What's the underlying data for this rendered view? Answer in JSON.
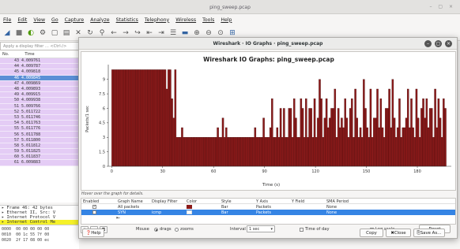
{
  "window": {
    "title": "ping_sweep.pcap",
    "controls": "– ▢ ×"
  },
  "menubar": [
    "File",
    "Edit",
    "View",
    "Go",
    "Capture",
    "Analyze",
    "Statistics",
    "Telephony",
    "Wireless",
    "Tools",
    "Help"
  ],
  "filter": {
    "placeholder": "Apply a display filter … <Ctrl-/>"
  },
  "packet_list": {
    "columns": [
      "No.",
      "Time"
    ],
    "rows": [
      {
        "no": "43",
        "time": "4.009761"
      },
      {
        "no": "44",
        "time": "4.009787"
      },
      {
        "no": "45",
        "time": "4.009818"
      },
      {
        "no": "46",
        "time": "4.009845"
      },
      {
        "no": "47",
        "time": "4.009869"
      },
      {
        "no": "48",
        "time": "4.009893"
      },
      {
        "no": "49",
        "time": "4.009915"
      },
      {
        "no": "50",
        "time": "4.009938"
      },
      {
        "no": "51",
        "time": "5.009766"
      },
      {
        "no": "52",
        "time": "5.011722"
      },
      {
        "no": "53",
        "time": "5.011746"
      },
      {
        "no": "54",
        "time": "5.011763"
      },
      {
        "no": "55",
        "time": "5.011776"
      },
      {
        "no": "56",
        "time": "5.011788"
      },
      {
        "no": "57",
        "time": "5.011800"
      },
      {
        "no": "58",
        "time": "5.011812"
      },
      {
        "no": "59",
        "time": "5.011825"
      },
      {
        "no": "60",
        "time": "5.011837"
      },
      {
        "no": "61",
        "time": "6.009883"
      }
    ],
    "selected_index": 3
  },
  "details": [
    "▸ Frame 46: 42 bytes",
    "▸ Ethernet II, Src: V",
    "▸ Internet Protocol V",
    "▸ Internet Control Me"
  ],
  "hex": [
    {
      "offset": "0000",
      "bytes": "00 00 00 00 00"
    },
    {
      "offset": "0010",
      "bytes": "00 1c 55 7f 00"
    },
    {
      "offset": "0020",
      "bytes": "2f 17 08 00 ec"
    }
  ],
  "io_dialog": {
    "window_title": "Wireshark · IO Graphs · ping_sweep.pcap",
    "hover_hint": "Hover over the graph for details.",
    "columns": [
      "Enabled",
      "Graph Name",
      "Display Filter",
      "Color",
      "Style",
      "Y Axis",
      "Y Field",
      "SMA Period"
    ],
    "graphs": [
      {
        "enabled": true,
        "name": "All packets",
        "filter": "",
        "color": "#8b1a1a",
        "style": "Bar",
        "y_axis": "Packets",
        "y_field": "",
        "sma": "None",
        "selected": false
      },
      {
        "enabled": false,
        "name": "SYN",
        "filter": "icmp",
        "color": "#ffffff",
        "style": "Bar",
        "y_axis": "Packets",
        "y_field": "",
        "sma": "None",
        "selected": true
      }
    ],
    "add_btn": "+",
    "remove_btn": "−",
    "copy_btn": "⧉",
    "mouse_label": "Mouse",
    "drags_label": "drags",
    "zooms_label": "zooms",
    "interval_label": "Interval",
    "interval_value": "1 sec",
    "time_of_day_label": "Time of day",
    "log_scale_label": "Log scale",
    "reset_btn": "Reset",
    "help_btn": "Help",
    "copy_text_btn": "Copy",
    "close_btn": "Close",
    "save_btn": "Save As…"
  },
  "chart_data": {
    "type": "bar",
    "title": "Wireshark IO Graphs: ping_sweep.pcap",
    "xlabel": "Time (s)",
    "ylabel": "Packets/1 sec",
    "xlim": [
      -2,
      200
    ],
    "ylim": [
      0,
      10.2
    ],
    "xticks": [
      0,
      30,
      60,
      90,
      120,
      150,
      180
    ],
    "yticks": [
      0,
      1.5,
      3,
      4.5,
      6,
      7.5,
      9
    ],
    "grid": false,
    "color": "#8b1a1a",
    "x": [
      0,
      1,
      2,
      3,
      4,
      5,
      6,
      7,
      8,
      9,
      10,
      11,
      12,
      13,
      14,
      15,
      16,
      17,
      18,
      19,
      20,
      21,
      22,
      23,
      24,
      25,
      26,
      27,
      28,
      29,
      30,
      31,
      32,
      33,
      34,
      35,
      36,
      37,
      38,
      39,
      40,
      41,
      42,
      43,
      44,
      45,
      46,
      47,
      48,
      49,
      50,
      51,
      52,
      53,
      54,
      55,
      56,
      57,
      58,
      59,
      60,
      61,
      62,
      63,
      64,
      65,
      66,
      67,
      68,
      69,
      70,
      71,
      72,
      73,
      74,
      75,
      76,
      77,
      78,
      79,
      80,
      81,
      82,
      83,
      84,
      85,
      86,
      87,
      88,
      89,
      90,
      91,
      92,
      93,
      94,
      95,
      96,
      97,
      98,
      99,
      100,
      101,
      102,
      103,
      104,
      105,
      106,
      107,
      108,
      109,
      110,
      111,
      112,
      113,
      114,
      115,
      116,
      117,
      118,
      119,
      120,
      121,
      122,
      123,
      124,
      125,
      126,
      127,
      128,
      129,
      130,
      131,
      132,
      133,
      134,
      135,
      136,
      137,
      138,
      139,
      140,
      141,
      142,
      143,
      144,
      145,
      146,
      147,
      148,
      149,
      150,
      151,
      152,
      153,
      154,
      155,
      156,
      157,
      158,
      159,
      160,
      161,
      162,
      163,
      164,
      165,
      166,
      167,
      168,
      169,
      170,
      171,
      172,
      173,
      174,
      175,
      176,
      177,
      178,
      179,
      180,
      181,
      182,
      183,
      184,
      185,
      186,
      187,
      188,
      189,
      190,
      191,
      192,
      193,
      194,
      195,
      196
    ],
    "values": [
      10,
      10,
      10,
      10,
      10,
      10,
      10,
      10,
      10,
      10,
      10,
      10,
      10,
      10,
      10,
      10,
      10,
      10,
      10,
      10,
      10,
      10,
      10,
      10,
      10,
      10,
      10,
      10,
      10,
      10,
      10,
      10,
      8,
      10,
      10,
      7,
      5,
      10,
      3,
      3,
      3,
      4,
      3,
      3,
      3,
      3,
      3,
      3,
      3,
      3,
      3,
      3,
      3,
      3,
      3,
      3,
      3,
      3,
      3,
      3,
      3,
      3,
      4,
      3,
      3,
      5,
      3,
      4,
      3,
      3,
      3,
      3,
      3,
      3,
      3,
      3,
      3,
      3,
      3,
      3,
      3,
      3,
      3,
      3,
      4,
      3,
      3,
      3,
      3,
      5,
      3,
      3,
      3,
      4,
      7,
      3,
      3,
      4,
      3,
      6,
      3,
      6,
      3,
      3,
      6,
      6,
      3,
      7,
      5,
      3,
      3,
      7,
      6,
      3,
      7,
      3,
      6,
      6,
      3,
      7,
      3,
      5,
      9,
      7,
      3,
      5,
      7,
      4,
      5,
      6,
      6,
      8,
      3,
      6,
      4,
      5,
      4,
      7,
      5,
      3,
      6,
      7,
      3,
      8,
      5,
      3,
      4,
      3,
      9,
      6,
      4,
      3,
      8,
      3,
      5,
      5,
      8,
      4,
      7,
      4,
      3,
      6,
      6,
      8,
      4,
      9,
      5,
      3,
      4,
      7,
      3,
      4,
      4,
      5,
      8,
      4,
      7,
      4,
      3,
      8,
      5,
      3,
      6,
      7,
      5,
      7,
      4,
      6,
      6,
      3,
      8,
      4,
      7,
      5,
      3,
      7,
      6
    ]
  }
}
